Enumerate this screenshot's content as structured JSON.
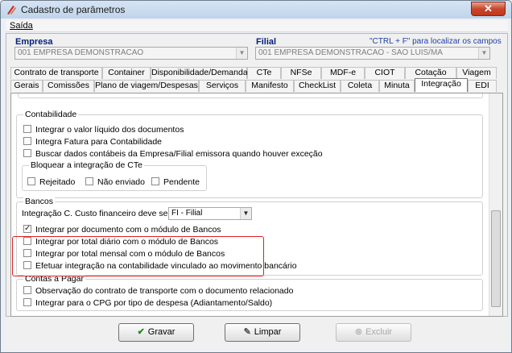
{
  "window": {
    "title": "Cadastro de parâmetros",
    "close_glyph": "✕"
  },
  "menu": {
    "saida": "Saída"
  },
  "header": {
    "empresa_label": "Empresa",
    "empresa_value": "001 EMPRESA DEMONSTRACAO",
    "filial_label": "Filial",
    "filial_value": "001 EMPRESA DEMONSTRACAO - SAO LUIS/MA",
    "hint": "\"CTRL + F\" para localizar os campos"
  },
  "tabs_row1": [
    "Contrato de transporte",
    "Container",
    "Disponibilidade/Demanda",
    "CTe",
    "NFSe",
    "MDF-e",
    "CIOT",
    "Cotação",
    "Viagem"
  ],
  "tabs_row2": [
    "Gerais",
    "Comissões",
    "Plano de viagem/Despesas",
    "Serviços",
    "Manifesto",
    "CheckList",
    "Coleta",
    "Minuta",
    "Integração",
    "EDI"
  ],
  "active_tab": "Integração",
  "contabilidade": {
    "title": "Contabilidade",
    "items": [
      {
        "label": "Integrar o valor líquido dos documentos",
        "checked": false
      },
      {
        "label": "Integra Fatura para Contabilidade",
        "checked": false
      },
      {
        "label": "Buscar dados contábeis da Empresa/Filial emissora quando houver exceção",
        "checked": false
      }
    ],
    "bloquear": {
      "title": "Bloquear a integração de CTe",
      "items": [
        {
          "label": "Rejeitado",
          "checked": false
        },
        {
          "label": "Não enviado",
          "checked": false
        },
        {
          "label": "Pendente",
          "checked": false
        }
      ]
    }
  },
  "bancos": {
    "title": "Bancos",
    "custo_label": "Integração C. Custo financeiro deve ser por",
    "custo_value": "FI   - Filial",
    "items": [
      {
        "label": "Integrar por documento com o módulo de Bancos",
        "checked": true
      },
      {
        "label": "Integrar por total diário com o módulo de Bancos",
        "checked": false
      },
      {
        "label": "Integrar por total mensal com o módulo de Bancos",
        "checked": false
      },
      {
        "label": "Efetuar integração na contabilidade vinculado ao movimento bancário",
        "checked": false
      }
    ]
  },
  "contas_pagar": {
    "title": "Contas a Pagar",
    "items": [
      {
        "label": "Observação do contrato de transporte com o documento relacionado",
        "checked": false
      },
      {
        "label": "Integrar para o CPG por tipo de despesa (Adiantamento/Saldo)",
        "checked": false
      }
    ]
  },
  "buttons": {
    "gravar": "Gravar",
    "limpar": "Limpar",
    "excluir": "Excluir"
  },
  "colors": {
    "highlight": "#e02020",
    "label_blue": "#001f7a",
    "hint_blue": "#1f3fa8"
  }
}
